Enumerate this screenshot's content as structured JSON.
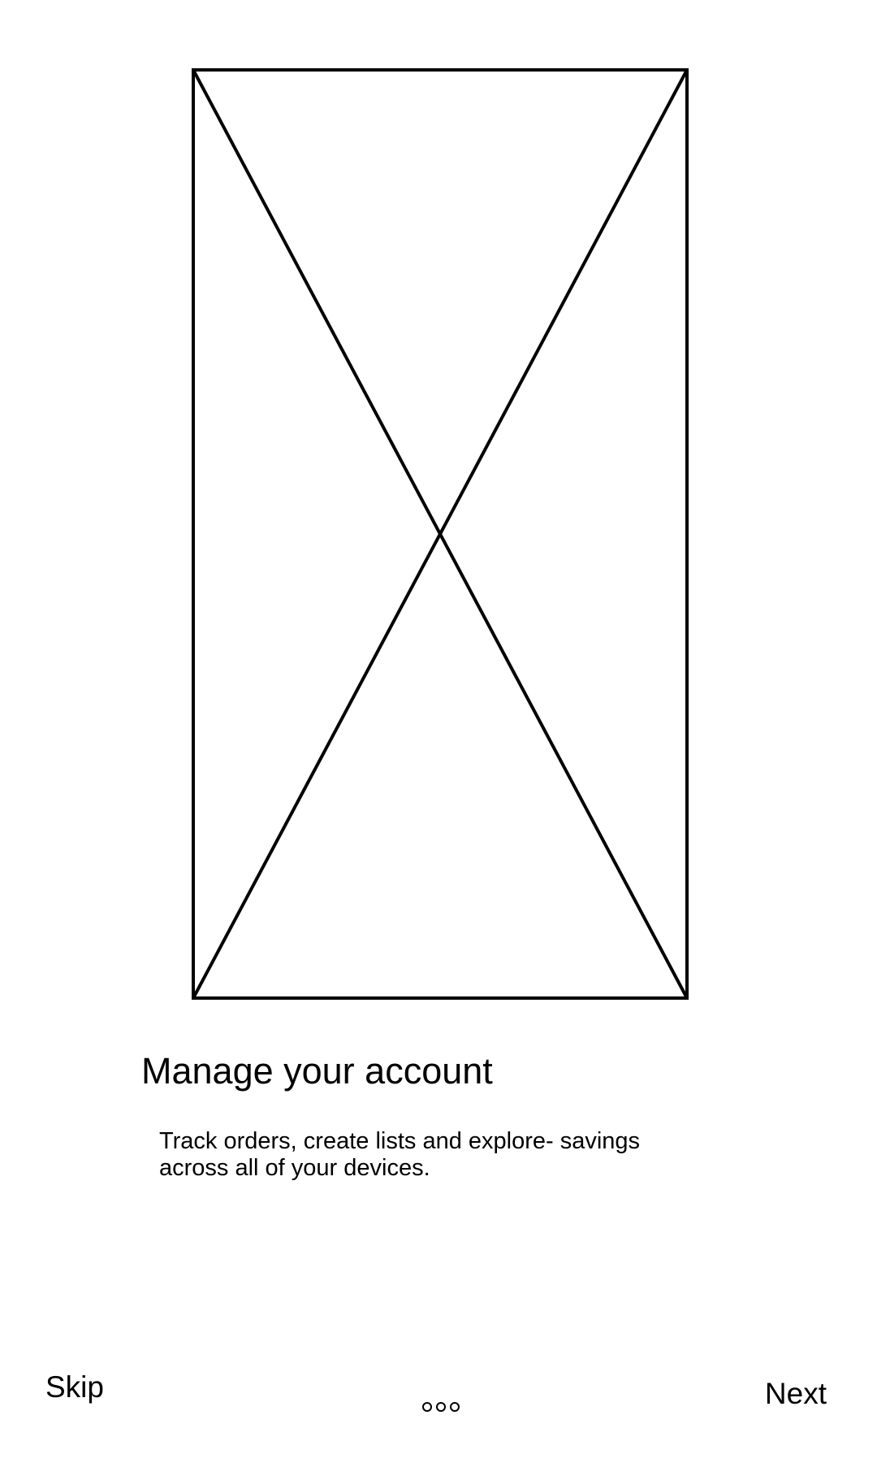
{
  "onboarding": {
    "title": "Manage your account",
    "description_lines": [
      "Track orders, create lists and explore- savings",
      "across all of your devices."
    ]
  },
  "footer": {
    "skip_label": "Skip",
    "next_label": "Next",
    "page_count": 3
  },
  "icons": {
    "hero": "image-placeholder-icon",
    "dots": "page-dot-icon"
  },
  "colors": {
    "background": "#ffffff",
    "foreground": "#000000"
  }
}
